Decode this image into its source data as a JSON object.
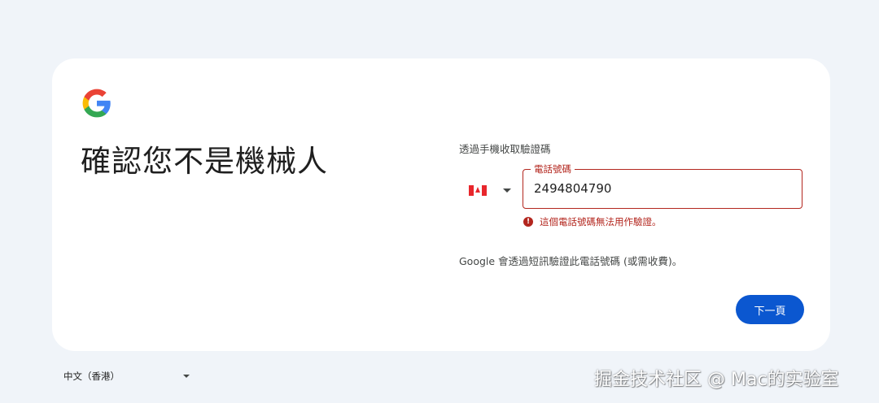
{
  "page": {
    "title": "確認您不是機械人",
    "section_label": "透過手機收取驗證碼",
    "info_text": "Google 會透過短訊驗證此電話號碼 (或需收費)。"
  },
  "country_select": {
    "flag_icon": "canada-flag-icon",
    "caret_icon": "caret-down-icon"
  },
  "phone_field": {
    "label": "電話號碼",
    "value": "2494804790",
    "error_text": "這個電話號碼無法用作驗證。",
    "error_icon": "error-alert-icon"
  },
  "buttons": {
    "next_label": "下一頁"
  },
  "footer": {
    "language_label": "中文（香港）",
    "caret_icon": "caret-down-icon"
  },
  "watermark": {
    "text": "掘金技术社区 @ Mac的实验室"
  },
  "colors": {
    "background": "#f0f4f9",
    "card": "#ffffff",
    "error": "#b3261e",
    "primary_button": "#0b57d0",
    "google_blue": "#4285f4",
    "google_red": "#ea4335",
    "google_yellow": "#fbbc05",
    "google_green": "#34a853"
  }
}
